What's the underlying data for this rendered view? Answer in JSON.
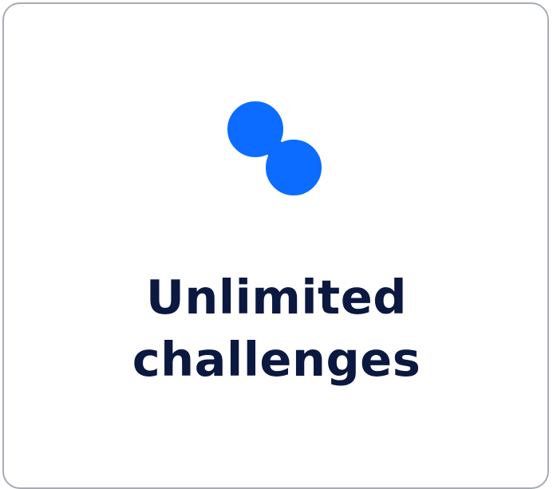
{
  "card": {
    "icon": "infinity-link-icon",
    "title_line1": "Unlimited",
    "title_line2": "challenges",
    "accent_color": "#0b6cff",
    "text_color": "#0b1840",
    "border_color": "#a6acb5"
  }
}
